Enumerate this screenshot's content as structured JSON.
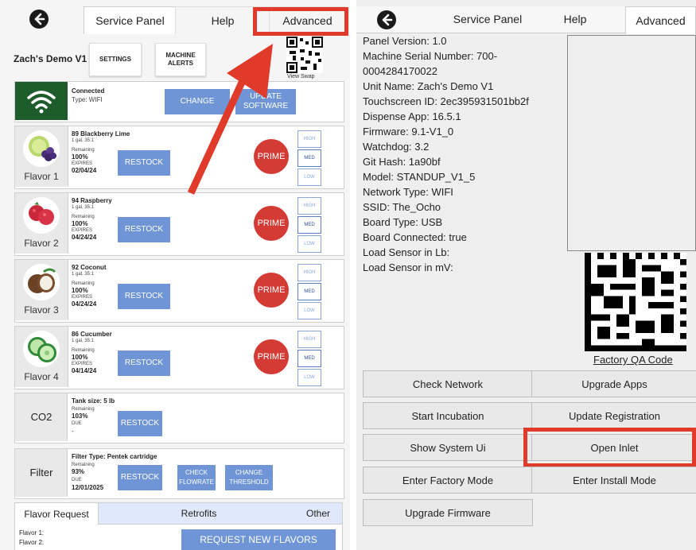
{
  "left": {
    "tabs": [
      "Service Panel",
      "Help",
      "Advanced"
    ],
    "machine_name": "Zach's Demo V1",
    "settings_label": "SETTINGS",
    "machine_alerts_label": "MACHINE ALERTS",
    "view_swap_label": "View Swap",
    "connection": {
      "status": "Connected",
      "type": "Type: WIFI",
      "change_label": "CHANGE",
      "update_label": "UPDATE SOFTWARE"
    },
    "flavors": [
      {
        "tile": "Flavor 1",
        "name": "89 Blackberry Lime",
        "size": "1 gal, 35:1",
        "remaining_label": "Remaining",
        "remaining": "100%",
        "expires_label": "EXPIRES",
        "expires": "02/04/24",
        "restock": "RESTOCK",
        "prime": "PRIME",
        "levels": [
          "HIGH",
          "MED",
          "LOW"
        ]
      },
      {
        "tile": "Flavor 2",
        "name": "94 Raspberry",
        "size": "1 gal, 35:1",
        "remaining_label": "Remaining",
        "remaining": "100%",
        "expires_label": "EXPIRES",
        "expires": "04/24/24",
        "restock": "RESTOCK",
        "prime": "PRIME",
        "levels": [
          "HIGH",
          "MED",
          "LOW"
        ]
      },
      {
        "tile": "Flavor 3",
        "name": "92 Coconut",
        "size": "1 gal, 35:1",
        "remaining_label": "Remaining",
        "remaining": "100%",
        "expires_label": "EXPIRES",
        "expires": "04/24/24",
        "restock": "RESTOCK",
        "prime": "PRIME",
        "levels": [
          "HIGH",
          "MED",
          "LOW"
        ]
      },
      {
        "tile": "Flavor 4",
        "name": "86 Cucumber",
        "size": "1 gal, 35:1",
        "remaining_label": "Remaining",
        "remaining": "100%",
        "expires_label": "EXPIRES",
        "expires": "04/14/24",
        "restock": "RESTOCK",
        "prime": "PRIME",
        "levels": [
          "HIGH",
          "MED",
          "LOW"
        ]
      }
    ],
    "co2": {
      "tile": "CO2",
      "tank": "Tank size: 5 lb",
      "remaining_label": "Remaining",
      "remaining": "103%",
      "due_label": "DUE",
      "due": "-",
      "restock": "RESTOCK"
    },
    "filter": {
      "tile": "Filter",
      "type": "Filter Type: Pentek cartridge",
      "remaining_label": "Remaining",
      "remaining": "93%",
      "due_label": "DUE",
      "due": "12/01/2025",
      "restock": "RESTOCK",
      "check_flowrate": "CHECK FLOWRATE",
      "change_threshold": "CHANGE THRESHOLD"
    },
    "bottom_tabs": [
      "Flavor Request",
      "Retrofits",
      "Other"
    ],
    "flavor_request_lines": [
      "Flavor 1:",
      "Flavor 2:"
    ],
    "request_new_label": "REQUEST NEW FLAVORS"
  },
  "right": {
    "tabs": [
      "Service Panel",
      "Help",
      "Advanced"
    ],
    "info": [
      "Panel Version: 1.0",
      "Machine Serial Number: 700-",
      "0004284170022",
      "Unit Name: Zach's Demo V1",
      "Touchscreen ID: 2ec395931501bb2f",
      "Dispense App: 16.5.1",
      "Firmware: 9.1-V1_0",
      "Watchdog: 3.2",
      "Git Hash: 1a90bf",
      "Model: STANDUP_V1_5",
      "Network Type: WIFI",
      "SSID: The_Ocho",
      "Board Type: USB",
      "Board Connected: true",
      "Load Sensor in Lb:",
      "Load Sensor in mV:"
    ],
    "factory_qa_label": "Factory QA Code",
    "buttons": [
      "Check Network",
      "Upgrade Apps",
      "Start Incubation",
      "Update Registration",
      "Show System Ui",
      "Open Inlet",
      "Enter Factory Mode",
      "Enter Install Mode",
      "Upgrade Firmware"
    ]
  },
  "colors": {
    "accent_blue": "#6f95d6",
    "prime_red": "#d43b34",
    "annotation_red": "#e03a2a",
    "wifi_green": "#1f5c2c"
  }
}
